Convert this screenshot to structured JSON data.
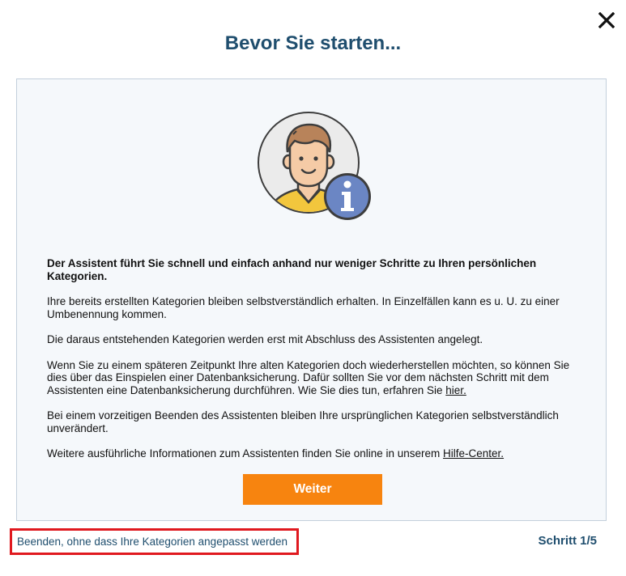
{
  "dialog": {
    "title": "Bevor Sie starten...",
    "close_icon": "close-icon"
  },
  "panel": {
    "illustration_icon": "user-info-icon",
    "info_badge_icon": "info-icon",
    "lead": "Der Assistent führt Sie schnell und einfach anhand nur weniger Schritte zu Ihren persönlichen Kategorien.",
    "para1": "Ihre bereits erstellten Kategorien bleiben selbstverständlich erhalten. In Einzelfällen kann es u. U. zu einer Umbenennung kommen.",
    "para2": "Die daraus entstehenden Kategorien werden erst mit Abschluss des Assistenten angelegt.",
    "para3_text": "Wenn Sie zu einem späteren Zeitpunkt Ihre alten Kategorien doch wiederherstellen möchten, so können Sie dies über das Einspielen einer Datenbanksicherung. Dafür sollten Sie vor dem nächsten Schritt mit dem Assistenten eine Datenbanksicherung durchführen. Wie Sie dies tun, erfahren Sie ",
    "para3_link": "hier.",
    "para4": "Bei einem vorzeitigen Beenden des Assistenten bleiben Ihre ursprünglichen Kategorien selbstverständlich unverändert.",
    "para5_text": "Weitere ausführliche Informationen zum Assistenten finden Sie online in unserem ",
    "para5_link": "Hilfe-Center.",
    "button_label": "Weiter"
  },
  "footer": {
    "quit_link": "Beenden, ohne dass Ihre Kategorien angepasst werden",
    "step": "Schritt 1/5"
  },
  "colors": {
    "title": "#1f4e6e",
    "button": "#f7840f",
    "panel_bg": "#f5f8fb",
    "highlight_border": "#e0191f"
  }
}
